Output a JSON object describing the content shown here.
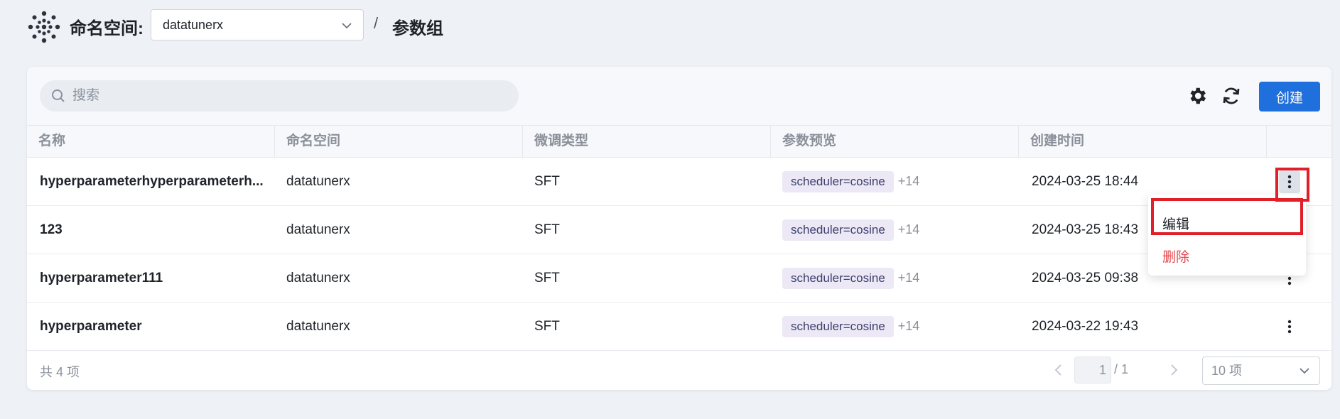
{
  "header": {
    "namespace_label": "命名空间:",
    "namespace_value": "datatunerx",
    "separator": "/",
    "page_title": "参数组"
  },
  "toolbar": {
    "search_placeholder": "搜索",
    "settings_icon": "gear-icon",
    "refresh_icon": "refresh-icon",
    "create_label": "创建"
  },
  "table": {
    "columns": [
      "名称",
      "命名空间",
      "微调类型",
      "参数预览",
      "创建时间"
    ],
    "rows": [
      {
        "name": "hyperparameterhyperparameterh...",
        "namespace": "datatunerx",
        "type": "SFT",
        "tag": "scheduler=cosine",
        "more": "+14",
        "created": "2024-03-25 18:44"
      },
      {
        "name": "123",
        "namespace": "datatunerx",
        "type": "SFT",
        "tag": "scheduler=cosine",
        "more": "+14",
        "created": "2024-03-25 18:43"
      },
      {
        "name": "hyperparameter111",
        "namespace": "datatunerx",
        "type": "SFT",
        "tag": "scheduler=cosine",
        "more": "+14",
        "created": "2024-03-25 09:38"
      },
      {
        "name": "hyperparameter",
        "namespace": "datatunerx",
        "type": "SFT",
        "tag": "scheduler=cosine",
        "more": "+14",
        "created": "2024-03-22 19:43"
      }
    ]
  },
  "footer": {
    "total": "共 4 项",
    "page_current": "1",
    "page_total": "/ 1",
    "page_size": "10 项"
  },
  "menu": {
    "edit": "编辑",
    "delete": "删除"
  },
  "colors": {
    "primary": "#1f6fdd",
    "danger": "#e5484d",
    "highlight": "#e01f28",
    "tag_bg": "#ece8f6"
  }
}
